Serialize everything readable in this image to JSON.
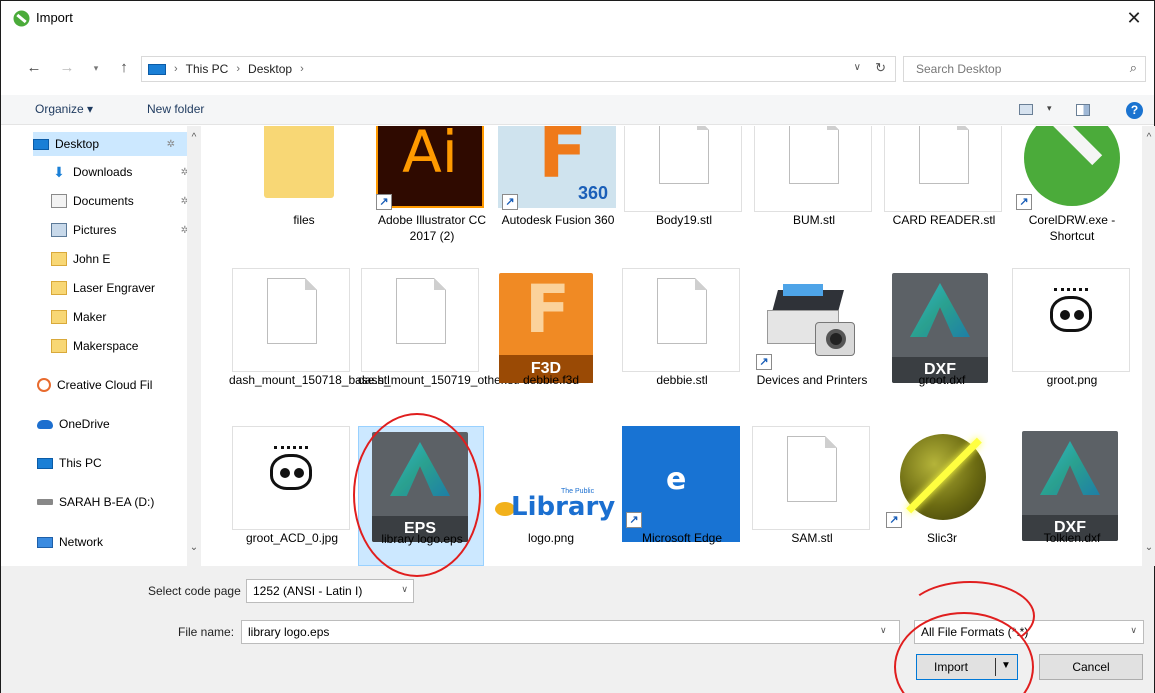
{
  "window": {
    "title": "Import",
    "close_glyph": "✕"
  },
  "nav": {
    "back": "←",
    "forward": "→",
    "recent": "▾",
    "up": "↑"
  },
  "address": {
    "crumbs": [
      "This PC",
      "Desktop"
    ],
    "sep": "›",
    "dropdown": "∨",
    "refresh": "↻"
  },
  "search": {
    "placeholder": "Search Desktop",
    "icon": "⌕"
  },
  "toolbar": {
    "organize": "Organize ▾",
    "new_folder": "New folder",
    "views_dd": "▾",
    "help": "?"
  },
  "sidebar": {
    "scroll_up": "^",
    "scroll_down": "⌄",
    "items": [
      {
        "label": "Desktop",
        "icon": "desktop-icon"
      },
      {
        "label": "Downloads",
        "icon": "download-icon"
      },
      {
        "label": "Documents",
        "icon": "documents-icon"
      },
      {
        "label": "Pictures",
        "icon": "pictures-icon"
      },
      {
        "label": "John E",
        "icon": "folder-icon"
      },
      {
        "label": "Laser Engraver",
        "icon": "folder-icon"
      },
      {
        "label": "Maker",
        "icon": "folder-icon"
      },
      {
        "label": "Makerspace",
        "icon": "folder-icon"
      },
      {
        "label": "Creative Cloud Fil",
        "icon": "creative-cloud-icon"
      },
      {
        "label": "OneDrive",
        "icon": "onedrive-icon"
      },
      {
        "label": "This PC",
        "icon": "this-pc-icon"
      },
      {
        "label": "SARAH B-EA (D:)",
        "icon": "drive-icon"
      },
      {
        "label": "Network",
        "icon": "network-icon"
      }
    ],
    "pin_glyph": "✲",
    "down_glyph": "⬇"
  },
  "files": {
    "row1": [
      "files",
      "Adobe Illustrator CC 2017 (2)",
      "Autodesk Fusion 360",
      "Body19.stl",
      "BUM.stl",
      "CARD READER.stl",
      "CorelDRW.exe - Shortcut"
    ],
    "row2": [
      "dash_mount_150718_base.stl",
      "dash_mount_150719_other.stl",
      "debbie.f3d",
      "debbie.stl",
      "Devices and Printers",
      "groot.dxf",
      "groot.png"
    ],
    "row3": [
      "groot_ACD_0.jpg",
      "library logo.eps",
      "logo.png",
      "Microsoft Edge",
      "SAM.stl",
      "Slic3r",
      "Tolkien.dxf"
    ],
    "thumb_text": {
      "ai": "Ai",
      "f360": "360",
      "f_glyph": "F",
      "f3d": "F3D",
      "dxf": "DXF",
      "eps": "EPS",
      "edge": "e",
      "library": "Library",
      "library_small": "The Public",
      "shortcut": "↗"
    },
    "scroll_up": "^",
    "scroll_down": "⌄"
  },
  "bottom": {
    "codepage_label": "Select code page",
    "codepage_value": "1252  (ANSI - Latin I)",
    "filename_label": "File name:",
    "filename_value": "library logo.eps",
    "filetype_value": "All File Formats (*.*)",
    "dd_glyph": "∨",
    "import_label": "Import",
    "import_arrow": "▼",
    "cancel_label": "Cancel"
  },
  "colors": {
    "accent": "#0078d7",
    "selection": "#cce8ff",
    "annotation": "#e01e1e"
  }
}
